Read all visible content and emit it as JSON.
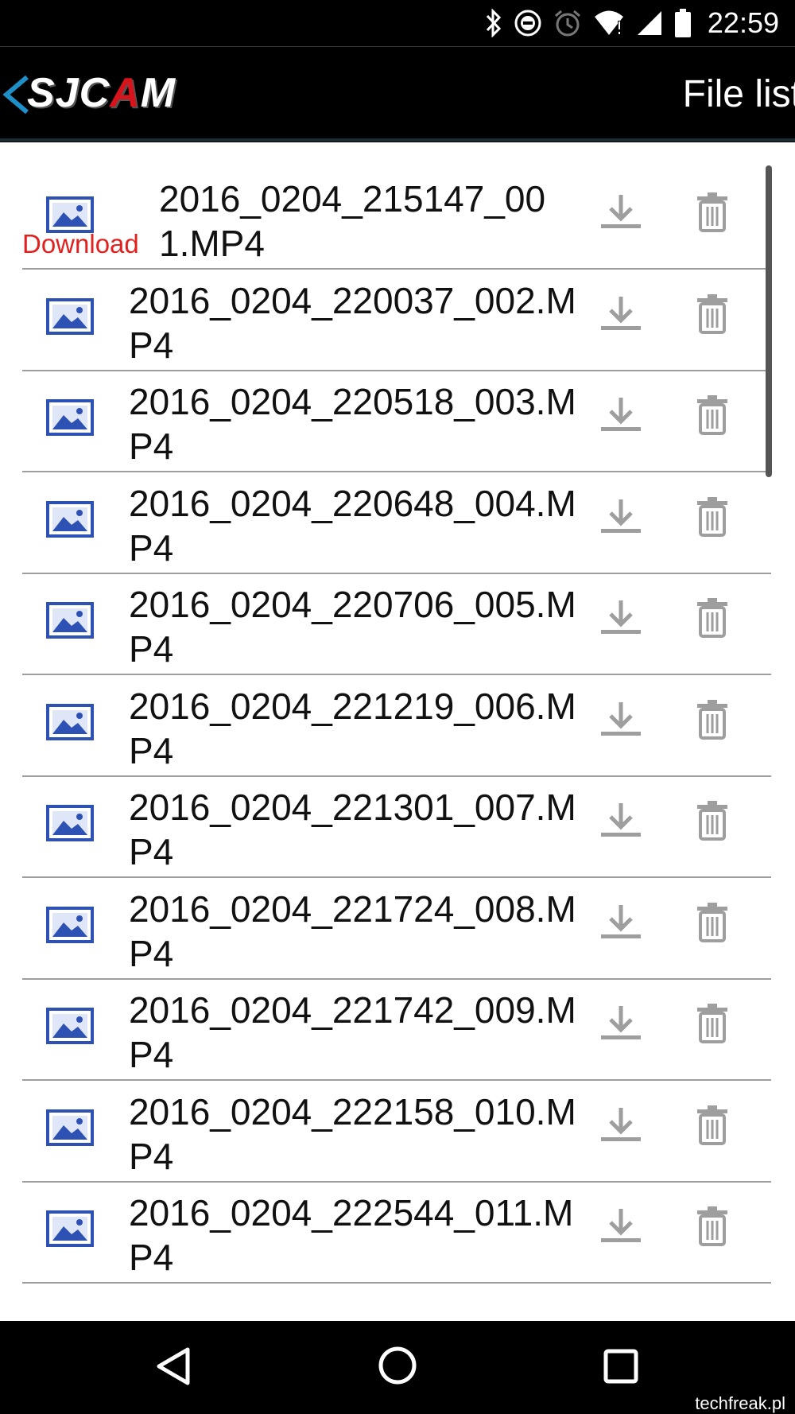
{
  "status_bar": {
    "time": "22:59",
    "icons": [
      "bluetooth-icon",
      "do-not-disturb-icon",
      "alarm-icon",
      "wifi-icon",
      "cell-signal-icon",
      "battery-icon"
    ]
  },
  "header": {
    "logo_left": "SJC",
    "logo_accent": "A",
    "logo_right": "M",
    "title": "File list",
    "logo_accent_color": "#d7141c"
  },
  "files": [
    {
      "name": "2016_0204_215147_001.MP4",
      "badge": "Download"
    },
    {
      "name": "2016_0204_220037_002.MP4"
    },
    {
      "name": "2016_0204_220518_003.MP4"
    },
    {
      "name": "2016_0204_220648_004.MP4"
    },
    {
      "name": "2016_0204_220706_005.MP4"
    },
    {
      "name": "2016_0204_221219_006.MP4"
    },
    {
      "name": "2016_0204_221301_007.MP4"
    },
    {
      "name": "2016_0204_221724_008.MP4"
    },
    {
      "name": "2016_0204_221742_009.MP4"
    },
    {
      "name": "2016_0204_222158_010.MP4"
    },
    {
      "name": "2016_0204_222544_011.MP4"
    }
  ],
  "colors": {
    "thumb_icon": "#2e51b4",
    "action_icon": "#9e9e9e",
    "download_badge": "#e0211f"
  },
  "watermark": "techfreak.pl"
}
